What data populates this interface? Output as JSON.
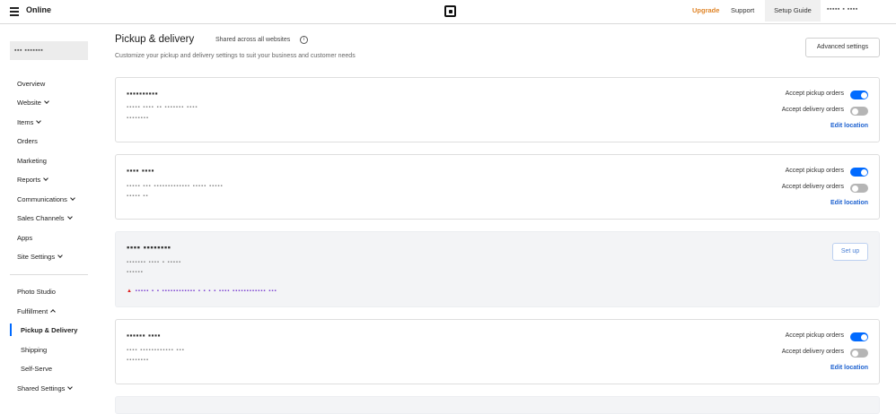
{
  "topbar": {
    "brand": "Online",
    "upgrade": "Upgrade",
    "support": "Support",
    "setup_guide": "Setup Guide",
    "account": "▪▪▪▪▪ ▪ ▪▪▪▪"
  },
  "sidebar": {
    "site_name": "▪▪▪ ▪▪▪▪▪▪▪",
    "items": [
      {
        "label": "Overview"
      },
      {
        "label": "Website"
      },
      {
        "label": "Items"
      },
      {
        "label": "Orders"
      },
      {
        "label": "Marketing"
      },
      {
        "label": "Reports"
      },
      {
        "label": "Communications"
      },
      {
        "label": "Sales Channels"
      },
      {
        "label": "Apps"
      },
      {
        "label": "Site Settings"
      },
      {
        "label": "Photo Studio"
      },
      {
        "label": "Fulfillment"
      },
      {
        "label": "Pickup & Delivery"
      },
      {
        "label": "Shipping"
      },
      {
        "label": "Self-Serve"
      },
      {
        "label": "Shared Settings"
      }
    ]
  },
  "main": {
    "title": "Pickup & delivery",
    "shared_note": "Shared across all websites",
    "subtitle": "Customize your pickup and delivery settings to suit your business and customer needs",
    "advanced_settings": "Advanced settings",
    "locations": [
      {
        "name": "▪▪▪▪▪▪▪▪▪▪",
        "line1": "▪▪▪▪▪ ▪▪▪▪ ▪▪ ▪▪▪▪▪▪▪ ▪▪▪▪",
        "line2": "▪▪▪▪▪▪▪▪",
        "pickup_label": "Accept pickup orders",
        "pickup_on": true,
        "delivery_label": "Accept delivery orders",
        "delivery_on": false,
        "edit": "Edit location"
      },
      {
        "name": "▪▪▪▪ ▪▪▪▪",
        "line1": "▪▪▪▪▪ ▪▪▪ ▪▪▪▪▪▪▪▪▪▪▪▪▪ ▪▪▪▪▪ ▪▪▪▪▪",
        "line2": "▪▪▪▪▪ ▪▪",
        "pickup_label": "Accept pickup orders",
        "pickup_on": true,
        "delivery_label": "Accept delivery orders",
        "delivery_on": false,
        "edit": "Edit location"
      },
      {
        "name": "▪▪▪▪ ▪▪▪▪▪▪▪▪",
        "line1": "▪▪▪▪▪▪▪ ▪▪▪▪ ▪ ▪▪▪▪▪",
        "line2": "▪▪▪▪▪▪",
        "warning": "▪▪▪▪▪ ▪ ▪ ▪▪▪▪▪▪▪▪▪▪▪▪ ▪ ▪ ▪ ▪ ▪▪▪▪ ▪▪▪▪▪▪▪▪▪▪▪▪ ▪▪▪",
        "setup": "Set up"
      },
      {
        "name": "▪▪▪▪▪▪ ▪▪▪▪",
        "line1": "▪▪▪▪ ▪▪▪▪▪▪▪▪▪▪▪▪ ▪▪▪",
        "line2": "▪▪▪▪▪▪▪▪",
        "pickup_label": "Accept pickup orders",
        "pickup_on": true,
        "delivery_label": "Accept delivery orders",
        "delivery_on": false,
        "edit": "Edit location"
      }
    ]
  },
  "colors": {
    "accent": "#006aff",
    "upgrade": "#e0862a",
    "link": "#1e62d0"
  },
  "icons": [
    "menu-icon",
    "square-logo-icon",
    "info-icon",
    "chevron-down-icon",
    "chevron-up-icon"
  ]
}
